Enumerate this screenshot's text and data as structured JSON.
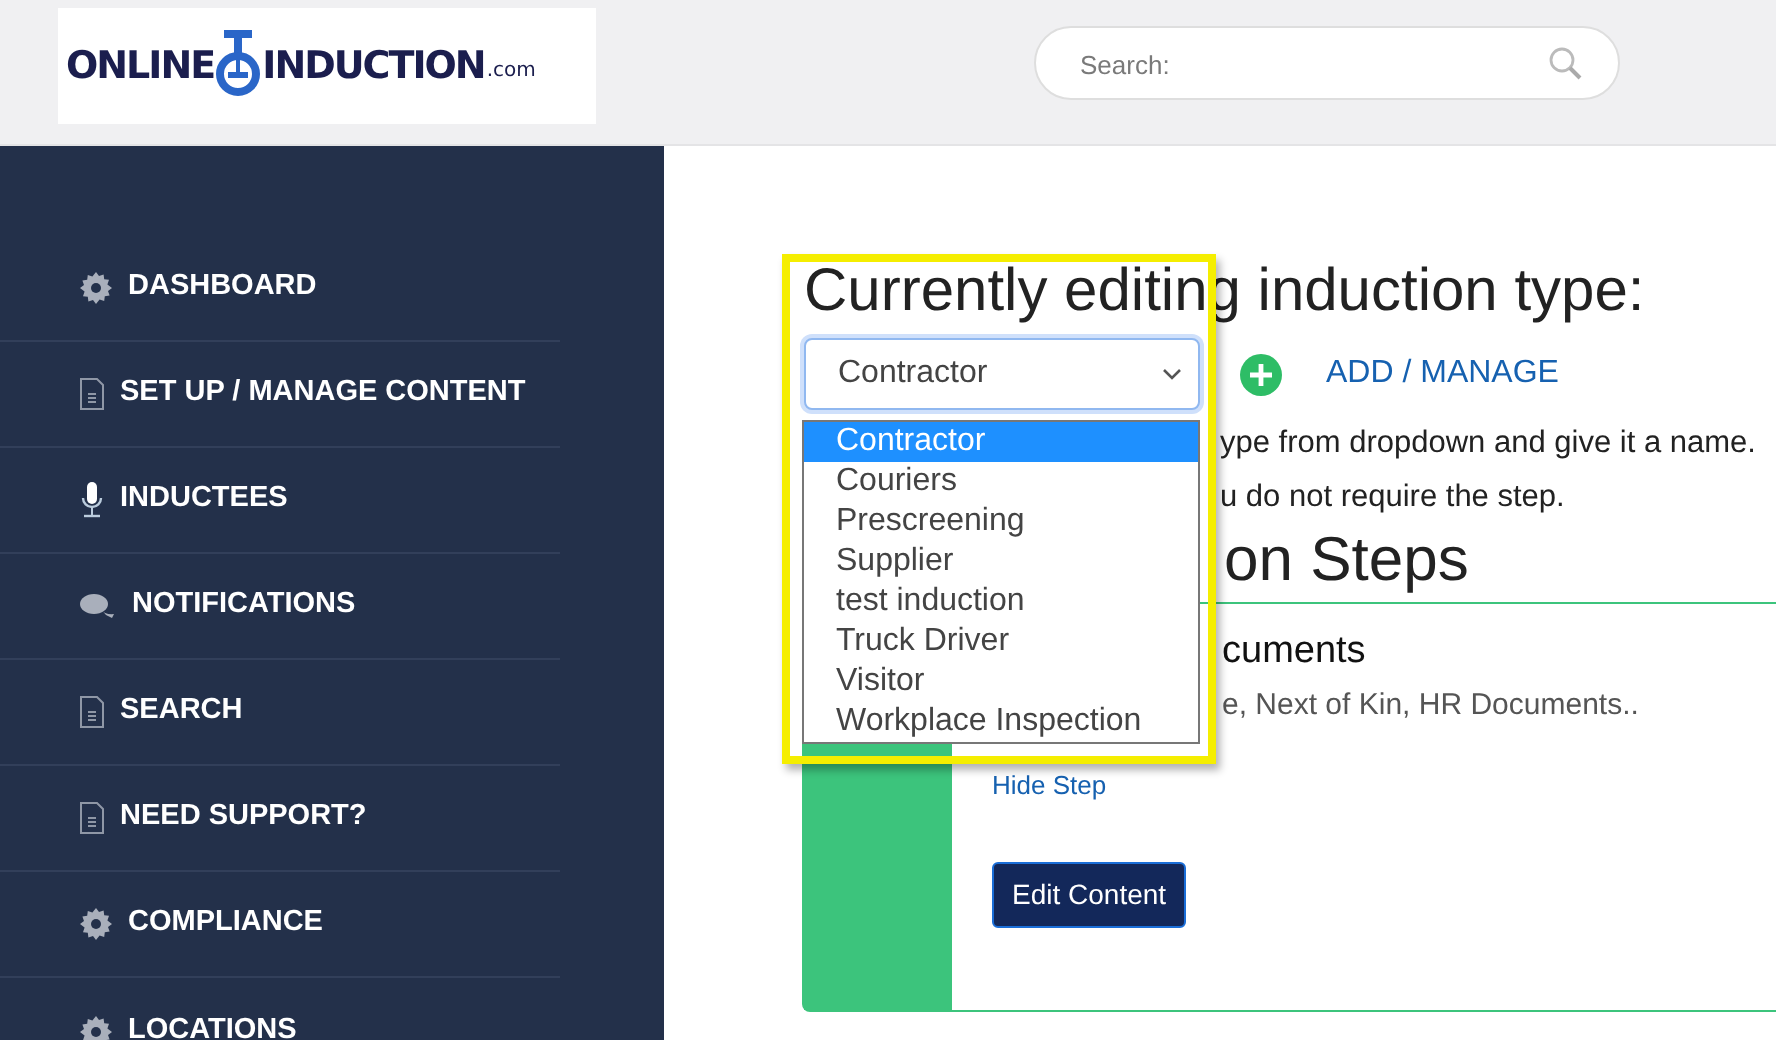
{
  "logo": {
    "word_1": "ONLINE",
    "word_2": "INDUCTION",
    "suffix": ".com"
  },
  "search": {
    "placeholder": "Search:"
  },
  "sidebar": {
    "items": [
      {
        "label": "DASHBOARD",
        "kind": "gear"
      },
      {
        "label": "SET UP / MANAGE CONTENT",
        "kind": "document"
      },
      {
        "label": "INDUCTEES",
        "kind": "microphone"
      },
      {
        "label": "NOTIFICATIONS",
        "kind": "chat"
      },
      {
        "label": "SEARCH",
        "kind": "document"
      },
      {
        "label": "NEED SUPPORT?",
        "kind": "document"
      },
      {
        "label": "COMPLIANCE",
        "kind": "gear"
      },
      {
        "label": "LOCATIONS",
        "kind": "gear"
      }
    ]
  },
  "main": {
    "heading": "Currently editing induction type:",
    "select": {
      "value": "Contractor",
      "expanded": true,
      "options": [
        {
          "label": "Contractor",
          "selected": true
        },
        {
          "label": "Couriers",
          "selected": false
        },
        {
          "label": "Prescreening",
          "selected": false
        },
        {
          "label": "Supplier",
          "selected": false
        },
        {
          "label": "test induction",
          "selected": false
        },
        {
          "label": "Truck Driver",
          "selected": false
        },
        {
          "label": "Visitor",
          "selected": false
        },
        {
          "label": "Workplace Inspection",
          "selected": false
        }
      ]
    },
    "add_link": "ADD / MANAGE",
    "help_lines": [
      "ype from dropdown and give it a name.",
      "u do not require the step."
    ],
    "section_heading": "on Steps",
    "step_card": {
      "title": "cuments",
      "description": "e, Next of Kin, HR Documents..",
      "hide_link": "Hide Step",
      "button": "Edit Content"
    }
  }
}
